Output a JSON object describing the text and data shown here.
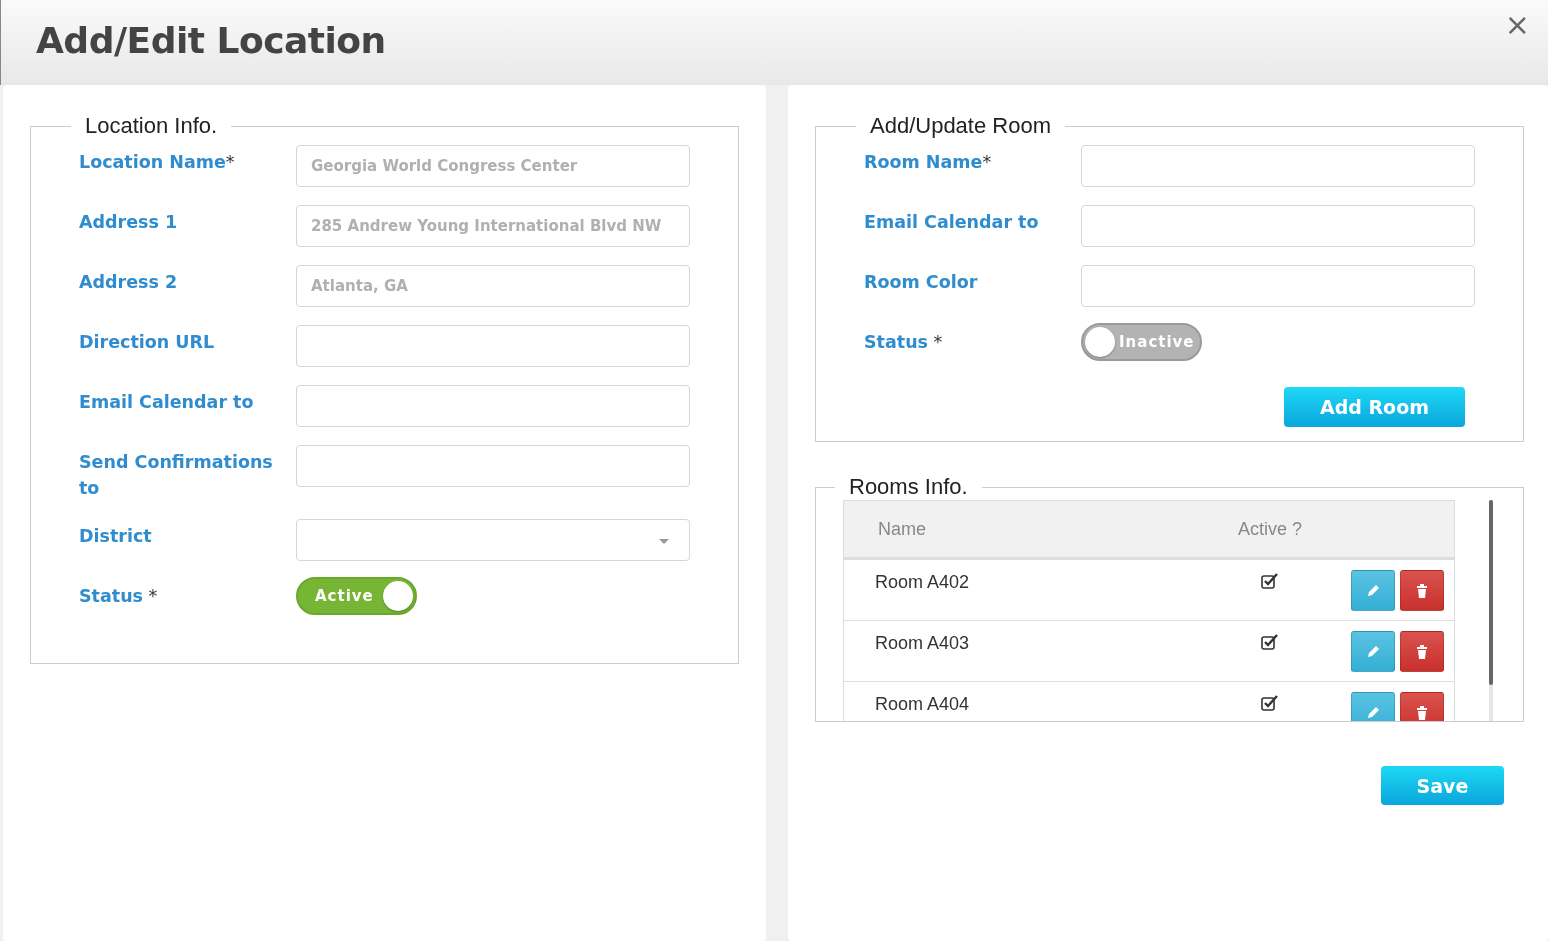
{
  "dialog": {
    "title": "Add/Edit Location",
    "close": "×"
  },
  "location_info": {
    "legend": "Location Info.",
    "fields": [
      {
        "kind": "text",
        "label": "Location Name",
        "mark": "*",
        "placeholder": "Georgia World Congress Center"
      },
      {
        "kind": "text",
        "label": "Address 1",
        "placeholder": "285 Andrew Young International Blvd NW"
      },
      {
        "kind": "text",
        "label": "Address 2",
        "placeholder": "Atlanta, GA"
      },
      {
        "kind": "text",
        "label": "Direction URL"
      },
      {
        "kind": "text",
        "label": "Email Calendar to"
      },
      {
        "kind": "text",
        "label": "Send Confirmations to"
      },
      {
        "kind": "select",
        "label": "District"
      },
      {
        "kind": "toggle",
        "label": "Status",
        "mark": " *",
        "on": true,
        "state_label": "Active"
      }
    ]
  },
  "add_update_room": {
    "legend": "Add/Update Room",
    "fields": [
      {
        "kind": "text",
        "label": "Room Name",
        "mark": "*"
      },
      {
        "kind": "text",
        "label": "Email Calendar to"
      },
      {
        "kind": "text",
        "label": "Room Color"
      },
      {
        "kind": "toggle",
        "label": "Status",
        "mark": " *",
        "on": false,
        "state_label": "Inactive"
      }
    ],
    "button": "Add Room"
  },
  "rooms_info": {
    "legend": "Rooms Info.",
    "columns": [
      "Name",
      "Active ?"
    ],
    "rows": [
      {
        "name": "Room A402",
        "active": true
      },
      {
        "name": "Room A403",
        "active": true
      },
      {
        "name": "Room A404",
        "active": true
      }
    ]
  },
  "save_button": "Save"
}
